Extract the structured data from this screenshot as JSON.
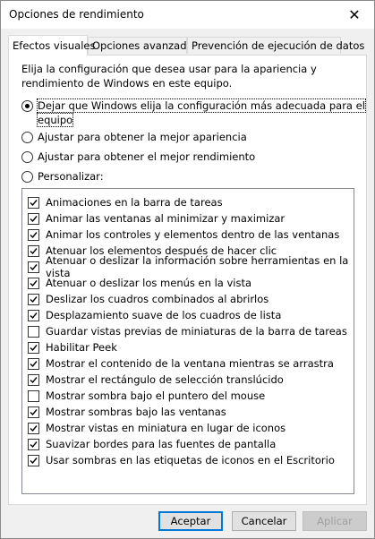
{
  "window": {
    "title": "Opciones de rendimiento",
    "close_glyph": "✕"
  },
  "tabs": [
    {
      "label": "Efectos visuales",
      "active": true
    },
    {
      "label": "Opciones avanzadas",
      "active": false
    },
    {
      "label": "Prevención de ejecución de datos",
      "active": false
    }
  ],
  "intro_text": "Elija la configuración que desea usar para la apariencia y rendimiento de Windows en este equipo.",
  "radio_options": [
    {
      "label_line1": "Dejar que Windows elija la configuración más adecuada para el",
      "label_line2": "equipo",
      "checked": true
    },
    {
      "label": "Ajustar para obtener la mejor apariencia",
      "checked": false
    },
    {
      "label": "Ajustar para obtener el mejor rendimiento",
      "checked": false
    },
    {
      "label": "Personalizar:",
      "checked": false
    }
  ],
  "effects": [
    {
      "label": "Animaciones en la barra de tareas",
      "checked": true
    },
    {
      "label": "Animar las ventanas al minimizar y maximizar",
      "checked": true
    },
    {
      "label": "Animar los controles y elementos dentro de las ventanas",
      "checked": true
    },
    {
      "label": "Atenuar los elementos después de hacer clic",
      "checked": true
    },
    {
      "label": "Atenuar o deslizar la información sobre herramientas en la vista",
      "checked": true
    },
    {
      "label": "Atenuar o deslizar los menús en la vista",
      "checked": true
    },
    {
      "label": "Deslizar los cuadros combinados al abrirlos",
      "checked": true
    },
    {
      "label": "Desplazamiento suave de los cuadros de lista",
      "checked": true
    },
    {
      "label": "Guardar vistas previas de miniaturas de la barra de tareas",
      "checked": false
    },
    {
      "label": "Habilitar Peek",
      "checked": true
    },
    {
      "label": "Mostrar el contenido de la ventana mientras se arrastra",
      "checked": true
    },
    {
      "label": "Mostrar el rectángulo de selección translúcido",
      "checked": true
    },
    {
      "label": "Mostrar sombra bajo el puntero del mouse",
      "checked": false
    },
    {
      "label": "Mostrar sombras bajo las ventanas",
      "checked": true
    },
    {
      "label": "Mostrar vistas en miniatura en lugar de iconos",
      "checked": true
    },
    {
      "label": "Suavizar bordes para las fuentes de pantalla",
      "checked": true
    },
    {
      "label": "Usar sombras en las etiquetas de iconos en el Escritorio",
      "checked": true
    }
  ],
  "buttons": {
    "accept": "Aceptar",
    "cancel": "Cancelar",
    "apply": "Aplicar"
  },
  "colors": {
    "accent": "#0078d7",
    "disabled_text": "#a0a0a0"
  }
}
